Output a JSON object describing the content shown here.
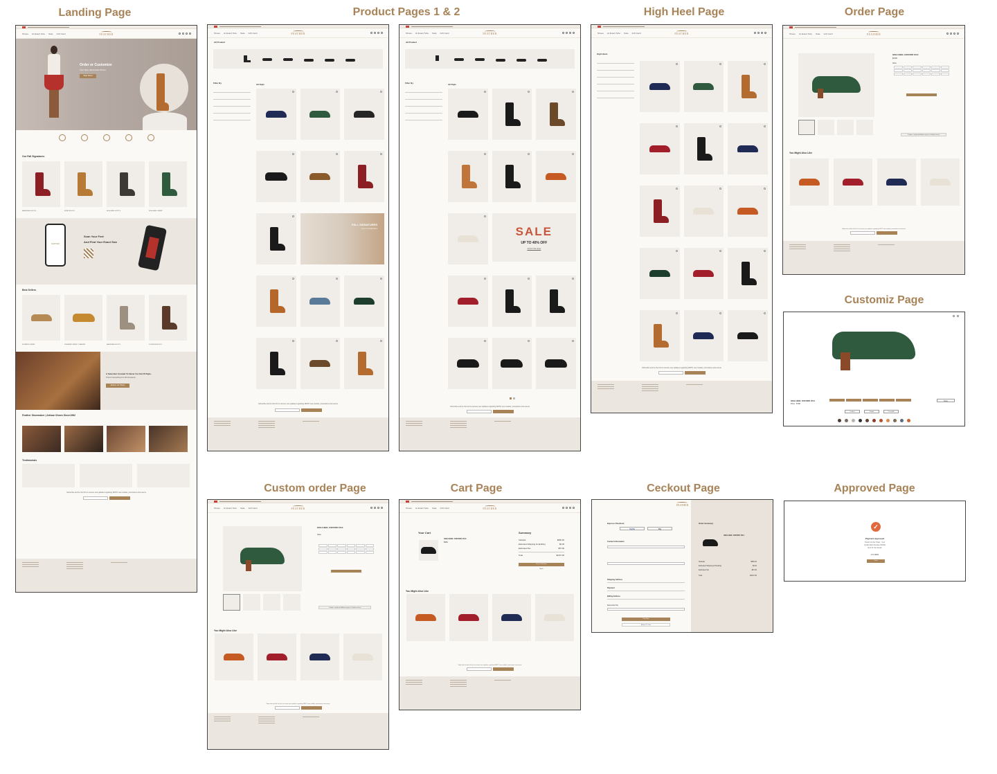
{
  "titles": {
    "landing": "Landing Page",
    "product": "Product Pages 1 & 2",
    "highheel": "High Heel Page",
    "order": "Order Page",
    "customiz": "Customiz Page",
    "custom_order": "Custom order Page",
    "cart": "Cart Page",
    "checkout": "Ceckout Page",
    "approved": "Approved Page"
  },
  "brand": {
    "logo": "FEATHER",
    "gold": "#a88358",
    "sale_red": "#c8553b",
    "cream": "#fbf9f6",
    "beige": "#ebe6df"
  },
  "nav": {
    "links": [
      "Shoes",
      "At Exact Size",
      "Sale",
      "Gift Card"
    ]
  },
  "landing": {
    "hero_title": "Order or Customize",
    "hero_sub": "Your New Handmade Shoes",
    "hero_btn": "Shop Shoes",
    "fall": "Our Fall Signatures",
    "fall_items": [
      "BALMORAL BOOTS",
      "MONK BOOTS",
      "HIGH HEEL BOOTS",
      "HIGH HEEL DERBY"
    ],
    "scan_title1": "Scan Your Feet",
    "scan_title2": "And Find Your Exact Size",
    "best": "Best Sellers",
    "best_items": [
      "WOMEN'S DERBY",
      "HORSEBIT PENNY LOAFERS",
      "BALMORAL BOOTS",
      "JODHPUR BOOTS"
    ],
    "promo1": "A Selection Created To Never Go Out Of Style.",
    "promo2": "There's Something For All Occasions.",
    "promo_btn": "Explore our Shoes",
    "about": "Feather Shoemaker | Artisan Shoes Since1982",
    "testimonials": "Testimonials",
    "subscribe": "Subscribe and be the first to receive new updates regarding DMTO new models, promotions and events"
  },
  "product": {
    "all_product": "All Product",
    "filter_by": "Filter By",
    "all_style": "All Style",
    "fall_sig": "FALL SIGNATURES",
    "shop_now": "SHOP NOW ARRIVALS",
    "sale": "SALE",
    "sale_sub": "UP TO 40% OFF",
    "sale_link": "SHOP THE SALE"
  },
  "highheel": {
    "heading": "High Heels"
  },
  "order": {
    "name": "HIGH HEEL OXFORD 1514",
    "price": "$768",
    "size": "Size",
    "also_like": "You Might Also Like",
    "customize_cta": "Custom - made and deliver to you in 4 weeks or less"
  },
  "customiz": {
    "name": "HIGH HEEL OXFORD 1514",
    "price": "Price : $768",
    "done": "Done",
    "materials": [
      "Leather",
      "Suede",
      "Crocodile"
    ],
    "swatches": [
      "#4a3a32",
      "#7a6a5e",
      "#b9b2a8",
      "#2f2f2f",
      "#5a4438",
      "#8d3b2b",
      "#b0532a",
      "#d88b4a",
      "#7e6a52",
      "#5d6b7a",
      "#c6652f"
    ]
  },
  "cart": {
    "your_cart": "Your Cart",
    "summary": "Summary",
    "item": "HIGH HEEL OXFORD 1514",
    "item_price": "$950",
    "rows": [
      {
        "label": "Subtotal",
        "value": "$950.00"
      },
      {
        "label": "Estimated Shipping & Handling",
        "value": "$0.00"
      },
      {
        "label": "Estimated Tax",
        "value": "$57.90"
      },
      {
        "label": "Total",
        "value": "$1007.90"
      }
    ],
    "go_checkout": "Go to Checkout",
    "back": "Back",
    "also_like": "You Might Also Like"
  },
  "checkout": {
    "express": "Express Checkout",
    "paypal": "PayPal",
    "applepay": "Pay",
    "contact": "Contact Information",
    "shipping": "Shipping Address",
    "payment": "Payment",
    "billing": "Billing Address",
    "remember": "Remember Me",
    "pay_now": "Pay Now",
    "return": "Return To Cart",
    "order_summary": "Order Summary",
    "item": "HIGH HEEL OXFORD 1514",
    "rows": [
      {
        "label": "Subtotal",
        "value": "$950.00"
      },
      {
        "label": "Estimated Shipping & Handling",
        "value": "$0.00"
      },
      {
        "label": "Estimated Tax",
        "value": "$57.90"
      },
      {
        "label": "Total",
        "value": "$1007.90"
      }
    ]
  },
  "approved": {
    "title": "Payment Approved",
    "line1": "Thank You For Order - Your",
    "line2": "Confirmation Number Will Be",
    "line3": "Sent To Your Email.",
    "number": "# 4719893",
    "btn": "Done"
  }
}
